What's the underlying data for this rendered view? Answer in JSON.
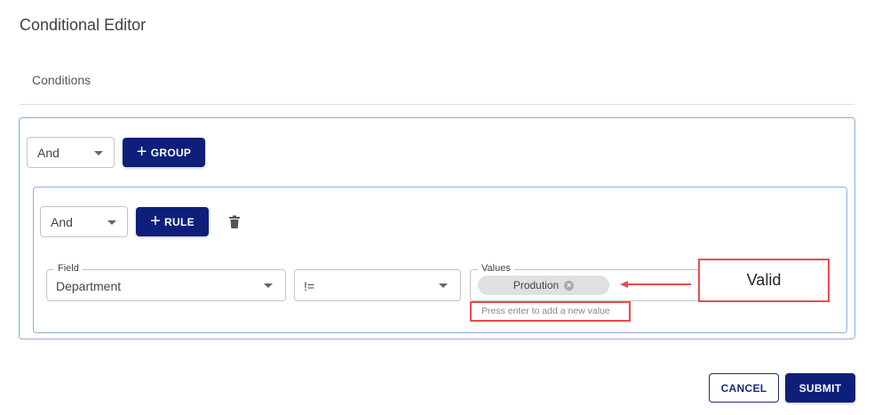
{
  "dialog": {
    "title": "Conditional Editor",
    "tab_label": "Conditions"
  },
  "group": {
    "combinator": "And",
    "add_group_label": "GROUP"
  },
  "rule_group": {
    "combinator": "And",
    "add_rule_label": "RULE"
  },
  "rule": {
    "field_label": "Field",
    "field_value": "Department",
    "operator_value": "!=",
    "values_label": "Values",
    "chips": [
      "Prodution"
    ],
    "helper_text": "Press enter to add a new value"
  },
  "annotation": {
    "text": "Valid"
  },
  "footer": {
    "cancel_label": "CANCEL",
    "submit_label": "SUBMIT"
  },
  "colors": {
    "primary": "#0d1f7a",
    "annotation_red": "#e74c4c",
    "box_border": "#8fb0d9"
  }
}
